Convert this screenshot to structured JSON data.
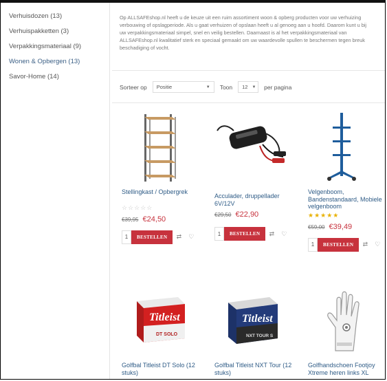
{
  "sidebar": {
    "categories": [
      {
        "label": "Verhuisdozen (13)"
      },
      {
        "label": "Verhuispakketten (3)"
      },
      {
        "label": "Verpakkingsmateriaal (9)"
      },
      {
        "label": "Wonen & Opbergen (13)"
      },
      {
        "label": "Savor-Home (14)"
      }
    ]
  },
  "intro": {
    "lines": [
      "Op ALLSAFEshop.nl heeft u de keuze uit een ruim assortiment woon & opberg producten voor uw verhuizing",
      "verbouwing of opslagperiode. Als u gaat verhuizen of opslaan heeft u al genoeg aan u hoofd. Daarom kunt u bij",
      "uw verpakkingsmateriaal simpel, snel en veilig bestellen. Daarnaast is al het verpakkingsmateriaal van",
      "ALLSAFEshop.nl kwalitatief sterk en speciaal gemaakt om uw waardevolle spullen te beschermen tegen breuk",
      "beschadiging of vocht."
    ]
  },
  "toolbar": {
    "sort_label": "Sorteer op",
    "sort_value": "Positie",
    "show_label": "Toon",
    "show_value": "12",
    "per_page_label": "per pagina"
  },
  "colors": {
    "accent": "#c7323d",
    "link": "#2e5b86",
    "star": "#e8b100"
  },
  "products": [
    {
      "name": "Stellingkast / Opbergrek",
      "old_price": "€39,95",
      "price": "€24,50",
      "rating": "☆☆☆☆☆",
      "button": "BESTELLEN",
      "qty": "1",
      "image_icon": "shelving-rack-image"
    },
    {
      "name": "Acculader, druppellader 6V/12V",
      "old_price": "€29,50",
      "price": "€22,90",
      "button": "BESTELLEN",
      "qty": "1",
      "image_icon": "battery-charger-image"
    },
    {
      "name": "Velgenboom, Bandenstandaard, Mobiele velgenboom",
      "old_price": "€59,00",
      "price": "€39,49",
      "rating": "★★★★★",
      "button": "BESTELLEN",
      "qty": "1",
      "image_icon": "tire-rack-image"
    },
    {
      "name": "Golfbal Titleist DT Solo (12 stuks)",
      "image_icon": "golf-ball-box-image",
      "box_brand": "Titleist",
      "box_model": "DT SOLO"
    },
    {
      "name": "Golfbal Titleist NXT Tour (12 stuks)",
      "image_icon": "golf-ball-box-image",
      "box_brand": "Titleist",
      "box_model": "NXT TOUR S"
    },
    {
      "name": "Golfhandschoen Footjoy Xtreme heren links XL",
      "image_icon": "golf-glove-image"
    }
  ]
}
